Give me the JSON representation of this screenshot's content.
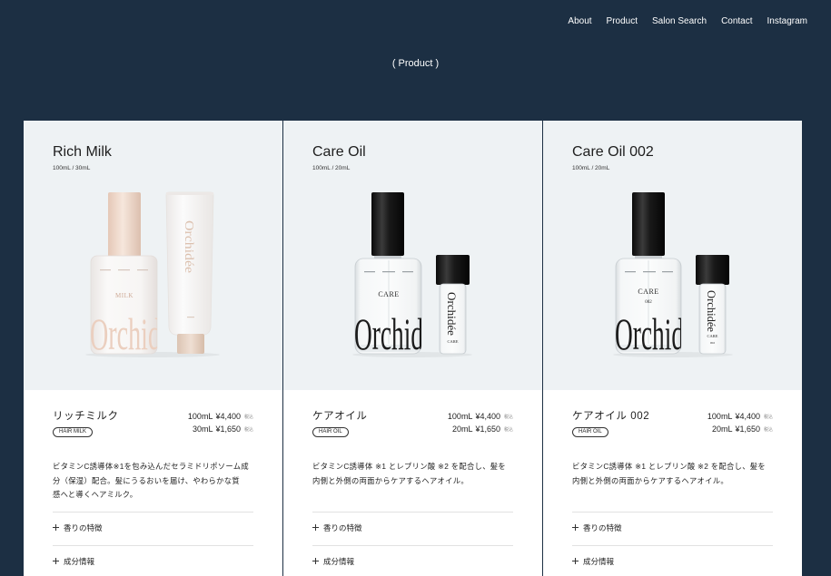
{
  "colors": {
    "background": "#1c2f43",
    "image_bg": "#eef2f4",
    "card_bg": "#ffffff",
    "text": "#222222",
    "divider": "#e2e2e2"
  },
  "nav": {
    "items": [
      {
        "label": "About"
      },
      {
        "label": "Product"
      },
      {
        "label": "Salon Search"
      },
      {
        "label": "Contact"
      },
      {
        "label": "Instagram"
      }
    ]
  },
  "section_title": "( Product )",
  "products": [
    {
      "name_en": "Rich Milk",
      "sizes": "100mL / 30mL",
      "name_ja": "リッチミルク",
      "badge": "HAIR MILK",
      "prices": [
        {
          "size": "100mL",
          "amount": "¥4,400",
          "tax": "税込"
        },
        {
          "size": "30mL",
          "amount": "¥1,650",
          "tax": "税込"
        }
      ],
      "description_lines": [
        "ビタミンC誘導体※1を包み込んだセラミドリポソーム成",
        "分（保湿）配合。髪にうるおいを届け、やわらかな質",
        "感へと導くヘアミルク。"
      ],
      "accordion": [
        {
          "icon": "plus-icon",
          "label": "香りの特徴"
        },
        {
          "icon": "plus-icon",
          "label": "成分情報"
        }
      ],
      "bottle": {
        "label": "MILK",
        "brand": "Orchid",
        "tube_brand": "Orchidée"
      }
    },
    {
      "name_en": "Care Oil",
      "sizes": "100mL / 20mL",
      "name_ja": "ケアオイル",
      "badge": "HAIR OIL",
      "prices": [
        {
          "size": "100mL",
          "amount": "¥4,400",
          "tax": "税込"
        },
        {
          "size": "20mL",
          "amount": "¥1,650",
          "tax": "税込"
        }
      ],
      "description_lines": [
        "ビタミンC誘導体 ※1 とレプリン酸 ※2 を配合し、髪を",
        "内側と外側の両面からケアするヘアオイル。"
      ],
      "accordion": [
        {
          "icon": "plus-icon",
          "label": "香りの特徴"
        },
        {
          "icon": "plus-icon",
          "label": "成分情報"
        }
      ],
      "bottle": {
        "label": "CARE",
        "brand": "Orchid",
        "mini_brand": "Orchidée",
        "mini_label": "CARE"
      }
    },
    {
      "name_en": "Care Oil 002",
      "sizes": "100mL / 20mL",
      "name_ja": "ケアオイル 002",
      "badge": "HAIR OIL",
      "prices": [
        {
          "size": "100mL",
          "amount": "¥4,400",
          "tax": "税込"
        },
        {
          "size": "20mL",
          "amount": "¥1,650",
          "tax": "税込"
        }
      ],
      "description_lines": [
        "ビタミンC誘導体 ※1 とレプリン酸 ※2 を配合し、髪を",
        "内側と外側の両面からケアするヘアオイル。"
      ],
      "accordion": [
        {
          "icon": "plus-icon",
          "label": "香りの特徴"
        },
        {
          "icon": "plus-icon",
          "label": "成分情報"
        }
      ],
      "bottle": {
        "label": "CARE",
        "variant": "002",
        "brand": "Orchid",
        "mini_brand": "Orchidée",
        "mini_label": "CARE",
        "mini_variant": "002"
      }
    }
  ]
}
